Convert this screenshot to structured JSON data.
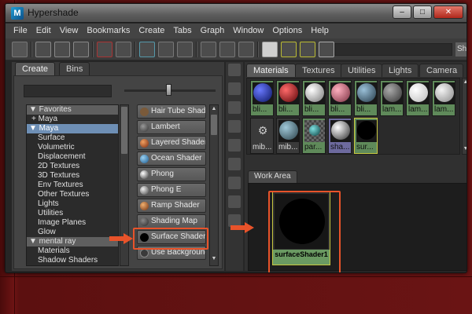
{
  "window": {
    "title": "Hypershade",
    "controls": {
      "minimize": "–",
      "maximize": "□",
      "close": "✕"
    }
  },
  "menu": [
    "File",
    "Edit",
    "View",
    "Bookmarks",
    "Create",
    "Tabs",
    "Graph",
    "Window",
    "Options",
    "Help"
  ],
  "toolbar": {
    "end_label": "Sh"
  },
  "left_panel": {
    "tabs": [
      {
        "label": "Create",
        "active": true
      },
      {
        "label": "Bins",
        "active": false
      }
    ],
    "tree": [
      {
        "label": "▼ Favorites",
        "kind": "header"
      },
      {
        "label": "+ Maya",
        "kind": "sub"
      },
      {
        "label": "▼ Maya",
        "kind": "selected"
      },
      {
        "label": "Surface",
        "kind": "child"
      },
      {
        "label": "Volumetric",
        "kind": "child"
      },
      {
        "label": "Displacement",
        "kind": "child"
      },
      {
        "label": "2D Textures",
        "kind": "child"
      },
      {
        "label": "3D Textures",
        "kind": "child"
      },
      {
        "label": "Env Textures",
        "kind": "child"
      },
      {
        "label": "Other Textures",
        "kind": "child"
      },
      {
        "label": "Lights",
        "kind": "child"
      },
      {
        "label": "Utilities",
        "kind": "child"
      },
      {
        "label": "Image Planes",
        "kind": "child"
      },
      {
        "label": "Glow",
        "kind": "child"
      },
      {
        "label": "▼ mental ray",
        "kind": "header"
      },
      {
        "label": "Materials",
        "kind": "child"
      },
      {
        "label": "Shadow Shaders",
        "kind": "child"
      }
    ],
    "shaders": [
      {
        "label": "Hair Tube Shader",
        "color": "#7a5a3a"
      },
      {
        "label": "Lambert",
        "color": "#555555"
      },
      {
        "label": "Layered Shader",
        "color": "#c86a3a"
      },
      {
        "label": "Ocean Shader",
        "color": "#2f7fb8"
      },
      {
        "label": "Phong",
        "color": "#666666"
      },
      {
        "label": "Phong E",
        "color": "#707070"
      },
      {
        "label": "Ramp Shader",
        "color": "#b06a3a"
      },
      {
        "label": "Shading Map",
        "color": "#5a5a5a"
      },
      {
        "label": "Surface Shader",
        "color": "#000000"
      },
      {
        "label": "Use Background",
        "color": "#3a3a3a"
      }
    ]
  },
  "right_panel": {
    "tabs": [
      "Materials",
      "Textures",
      "Utilities",
      "Lights",
      "Camera"
    ],
    "materials": [
      {
        "label": "bli...",
        "ball": "#1b2a8a",
        "style": "green"
      },
      {
        "label": "bli...",
        "ball": "#8a0f14",
        "style": "green"
      },
      {
        "label": "bli...",
        "ball": "#d8d8d8",
        "style": "green"
      },
      {
        "label": "bli...",
        "ball": "#c9738a",
        "style": "green"
      },
      {
        "label": "bli...",
        "ball": "#4d6f86",
        "style": "green"
      },
      {
        "label": "lam...",
        "ball": "#6a6a6a",
        "style": "green"
      },
      {
        "label": "lam...",
        "ball": "#f0f0f0",
        "style": "green"
      },
      {
        "label": "lam...",
        "ball": "#c8c8c8",
        "style": "green"
      },
      {
        "label": "mib...",
        "ball": "#2a2a2a",
        "style": "gray"
      },
      {
        "label": "mib...",
        "ball": "#5f7f8a",
        "style": "gray"
      },
      {
        "label": "par...",
        "ball": "#3a8a8a",
        "style": "green"
      },
      {
        "label": "sha...",
        "ball": "#e0e0e0",
        "style": "purple"
      },
      {
        "label": "sur...",
        "ball": "#000000",
        "style": "yellow"
      }
    ],
    "work_area_tab": "Work Area",
    "node_label": "surfaceShader1"
  },
  "colors": {
    "highlight": "#e8532a",
    "selected_tree": "#6e8fb5",
    "material_green": "#5f8a5a"
  }
}
